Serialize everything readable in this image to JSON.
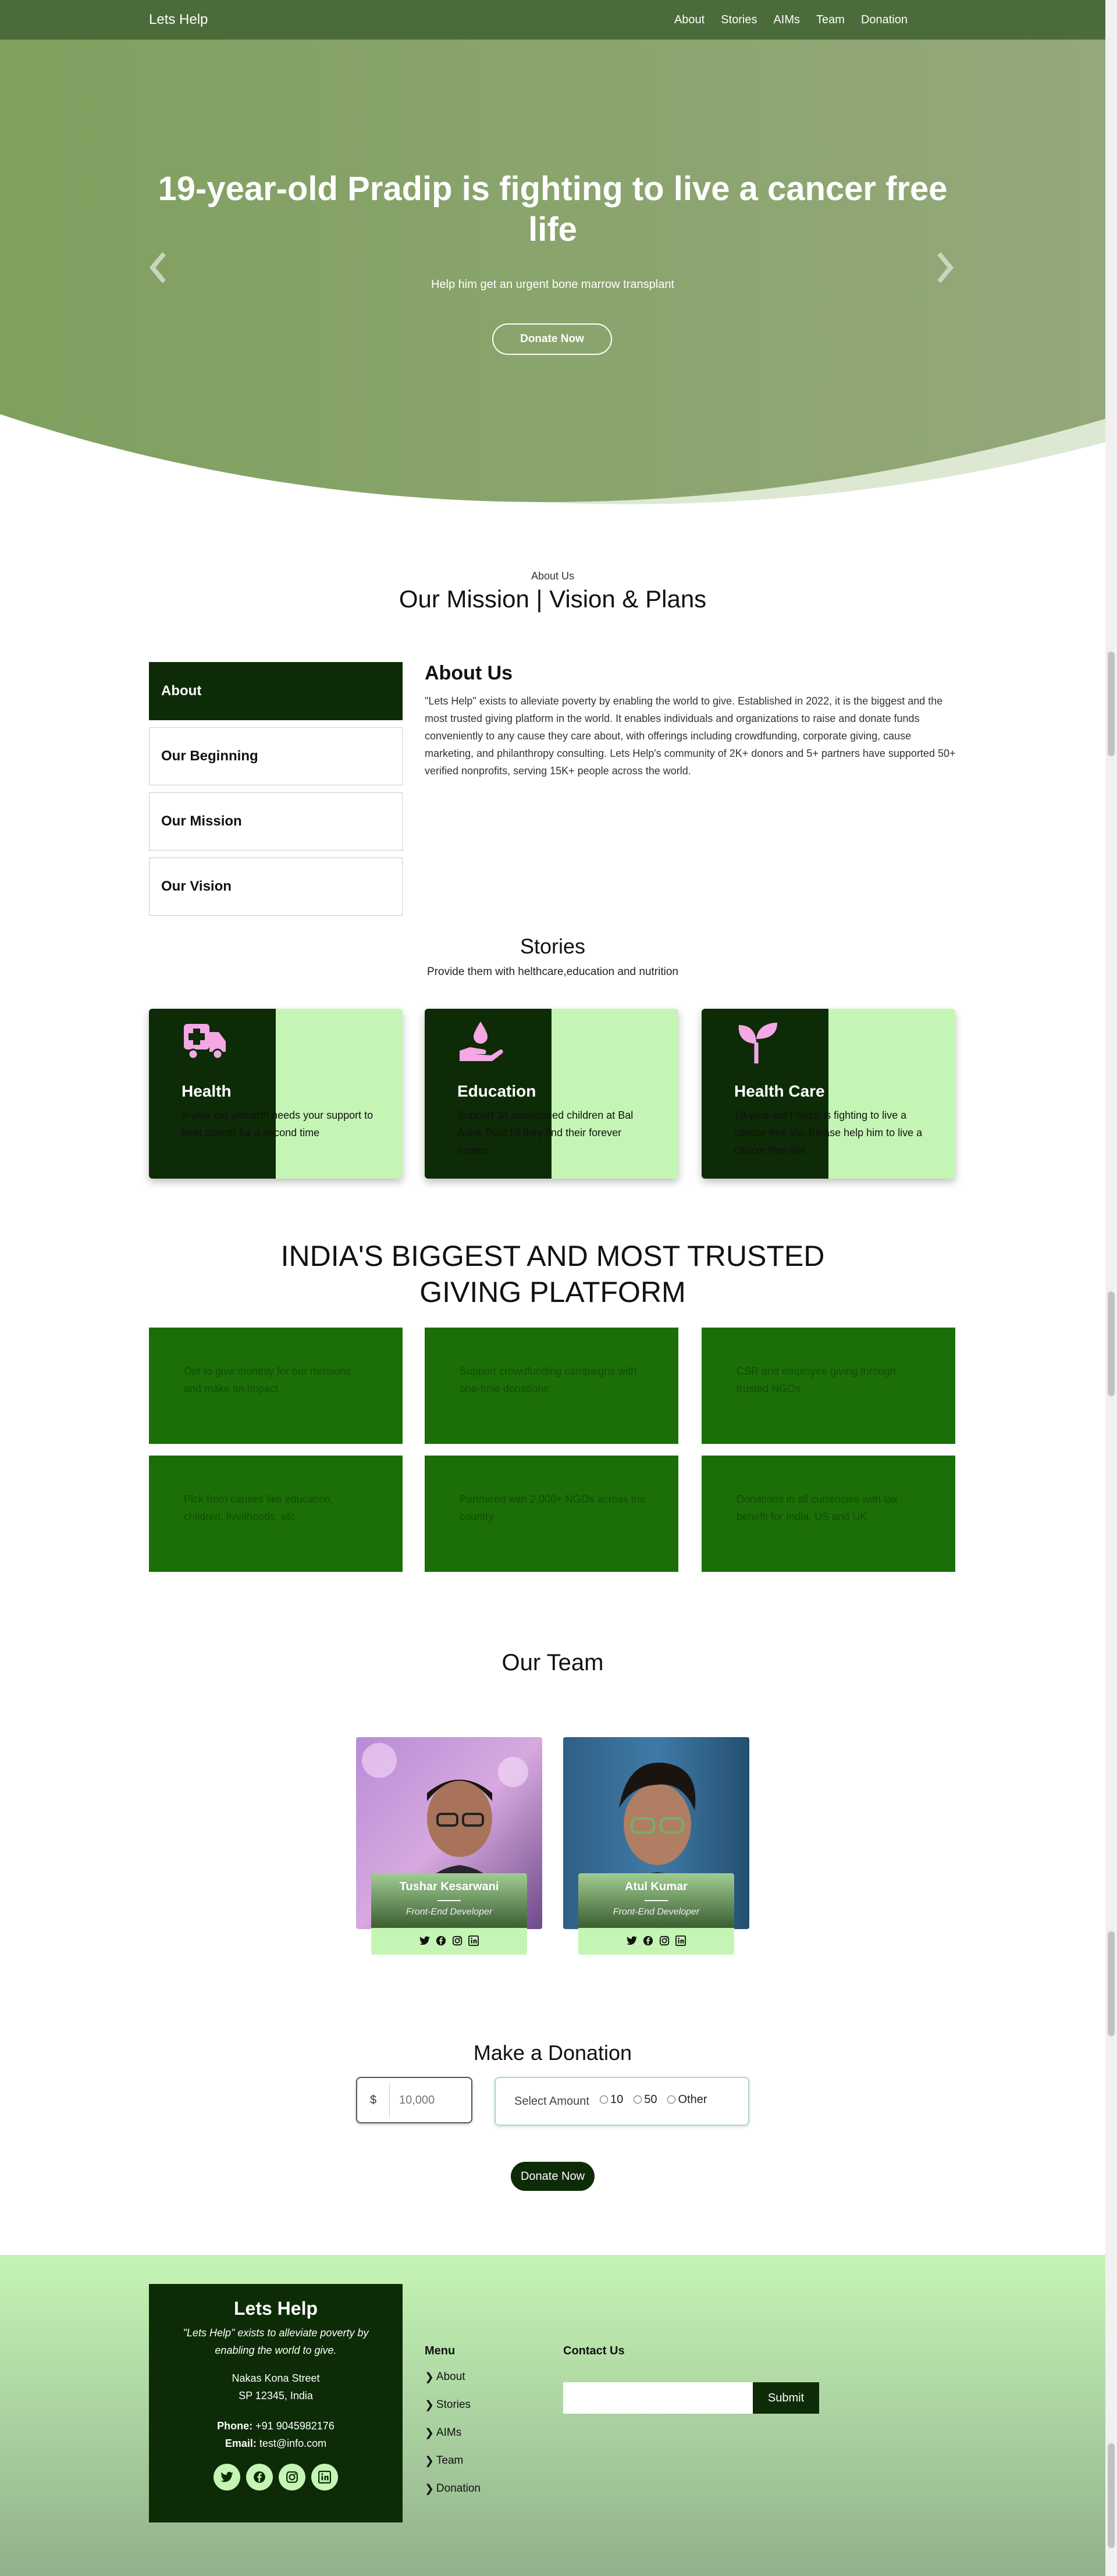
{
  "nav": {
    "brand": "Lets Help",
    "links": [
      "About",
      "Stories",
      "AIMs",
      "Team",
      "Donation"
    ]
  },
  "hero": {
    "title": "19-year-old Pradip is fighting to live a cancer free life",
    "subtitle": "Help him get an urgent bone marrow transplant",
    "button": "Donate Now"
  },
  "about": {
    "eyebrow": "About Us",
    "heading": "Our Mission | Vision & Plans",
    "tabs": [
      "About",
      "Our Beginning",
      "Our Mission",
      "Our Vision"
    ],
    "content_title": "About Us",
    "content_text": "\"Lets Help\" exists to alleviate poverty by enabling the world to give. Established in 2022, it is the biggest and the most trusted giving platform in the world. It enables individuals and organizations to raise and donate funds conveniently to any cause they care about, with offerings including crowdfunding, corporate giving, cause marketing, and philanthropy consulting. Lets Help's community of 2K+ donors and 5+ partners have supported 50+ verified nonprofits, serving 15K+ people across the world."
  },
  "stories": {
    "heading": "Stories",
    "subtitle": "Provide them with helthcare,education and nutrition",
    "cards": [
      {
        "icon": "ambulance-icon",
        "title": "Health",
        "text": "8-year old yatharth needs your support to beat cancer for a second time"
      },
      {
        "icon": "hand-drop-icon",
        "title": "Education",
        "text": "Support 34 abandoned children at Bal Asha Trust till they find their forever homes"
      },
      {
        "icon": "seedling-icon",
        "title": "Health Care",
        "text": "19-year-old Pradip is fighting to live a cancer free life. Please help him to live a cancer free life!"
      }
    ]
  },
  "platform": {
    "heading": "INDIA'S BIGGEST AND MOST TRUSTED GIVING PLATFORM",
    "items": [
      "Opt to give monthly for our missions and make an impact",
      "Support crowdfunding campaigns with one-time donations",
      "CSR and employee giving through trusted NGOs",
      "Pick from causes like education, children, livelihoods, etc",
      "Partnered with 2,000+ NGOs across the country",
      "Donations in all currencies with tax benefit for India, US and UK"
    ]
  },
  "team": {
    "heading": "Our Team",
    "members": [
      {
        "name": "Tushar Kesarwani",
        "role": "Front-End Developer"
      },
      {
        "name": "Atul Kumar",
        "role": "Front-End Developer"
      }
    ]
  },
  "donation": {
    "heading": "Make a Donation",
    "currency": "$",
    "amount_placeholder": "10,000",
    "select_label": "Select Amount",
    "options": [
      "10",
      "50",
      "Other"
    ],
    "button": "Donate Now"
  },
  "footer": {
    "name": "Lets Help",
    "tagline": "\"Lets Help\" exists to alleviate poverty by enabling the world to give.",
    "address_line1": "Nakas Kona Street",
    "address_line2": "SP 12345, India",
    "phone_label": "Phone:",
    "phone": "+91 9045982176",
    "email_label": "Email:",
    "email": "test@info.com",
    "menu_heading": "Menu",
    "menu_items": [
      "About",
      "Stories",
      "AIMs",
      "Team",
      "Donation"
    ],
    "contact_heading": "Contact Us",
    "submit": "Submit"
  },
  "colors": {
    "dark_green": "#0d2b06",
    "light_green": "#c5f5b5",
    "platform_green": "#1b6f06",
    "hero_green": "#8ea66f"
  }
}
